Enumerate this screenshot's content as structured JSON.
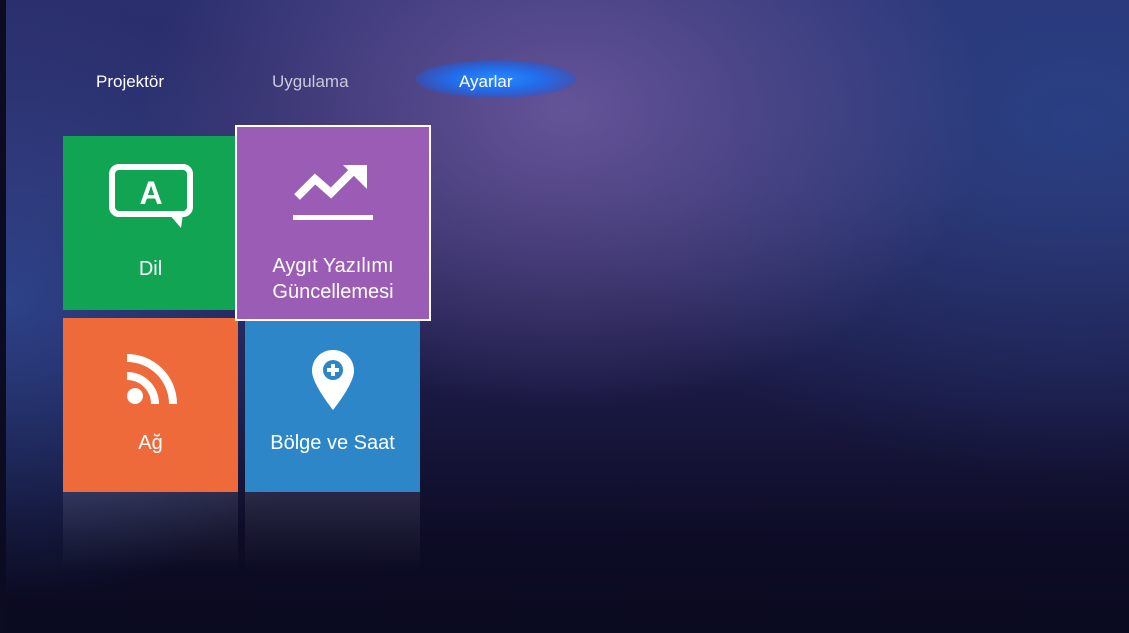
{
  "nav": {
    "tabs": [
      {
        "label": "Projektör",
        "active": false
      },
      {
        "label": "Uygulama",
        "active": false
      },
      {
        "label": "Ayarlar",
        "active": true
      }
    ]
  },
  "tiles": [
    {
      "label": "Dil",
      "icon": "language-icon",
      "color": "#11a453"
    },
    {
      "label_lines": [
        "Aygıt Yazılımı",
        "Güncellemesi"
      ],
      "icon": "trend-up-icon",
      "color": "#9a5cb4",
      "focused": true
    },
    {
      "label": "Ağ",
      "icon": "wifi-signal-icon",
      "color": "#ee6a3b"
    },
    {
      "label": "Bölge ve Saat",
      "icon": "location-pin-icon",
      "color": "#2c86c8"
    }
  ],
  "colors": {
    "active_tab_glow": "#2a8cff",
    "focus_border": "#ffffff"
  }
}
